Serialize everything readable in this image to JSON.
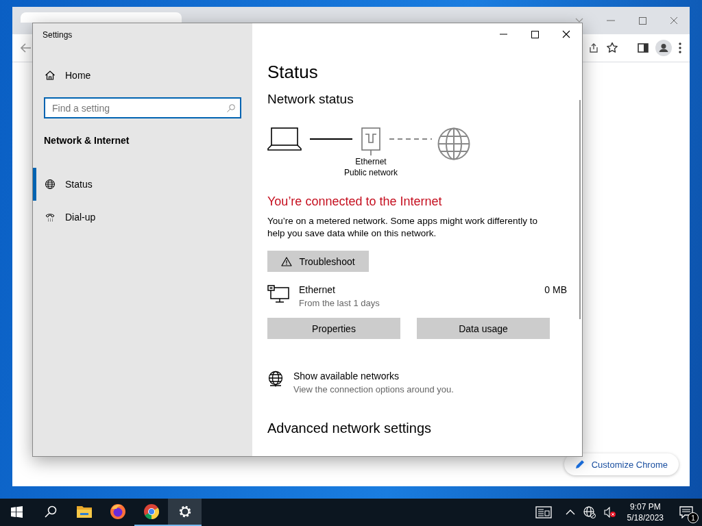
{
  "browser": {
    "customize_button": "Customize Chrome"
  },
  "settings": {
    "title": "Settings",
    "sidebar": {
      "home": "Home",
      "search": {
        "placeholder": "Find a setting"
      },
      "section": "Network & Internet",
      "items": [
        {
          "label": "Status",
          "kind": "status",
          "selected": true
        },
        {
          "label": "Dial-up",
          "kind": "dialup",
          "selected": false
        }
      ]
    },
    "content": {
      "heading": "Status",
      "subheading": "Network status",
      "diagram": {
        "adapter_label": "Ethernet",
        "network_label": "Public network"
      },
      "status": "You’re connected to the Internet",
      "description": "You’re on a metered network. Some apps might work differently to help you save data while on this network.",
      "troubleshoot": "Troubleshoot",
      "adapter": {
        "name": "Ethernet",
        "period": "From the last 1 days",
        "usage": "0 MB"
      },
      "buttons": [
        "Properties",
        "Data usage"
      ],
      "show_networks": {
        "title": "Show available networks",
        "subtitle": "View the connection options around you."
      },
      "advanced_heading": "Advanced network settings"
    }
  },
  "taskbar": {
    "apps": [
      {
        "kind": "start",
        "running": false,
        "active": false
      },
      {
        "kind": "search",
        "running": false,
        "active": false
      },
      {
        "kind": "files",
        "running": false,
        "active": false
      },
      {
        "kind": "firefox",
        "running": false,
        "active": false
      },
      {
        "kind": "chrome",
        "running": true,
        "active": false
      },
      {
        "kind": "settings",
        "running": true,
        "active": true
      }
    ],
    "clock": {
      "time": "9:07 PM",
      "date": "5/18/2023"
    },
    "notifications": "1"
  }
}
